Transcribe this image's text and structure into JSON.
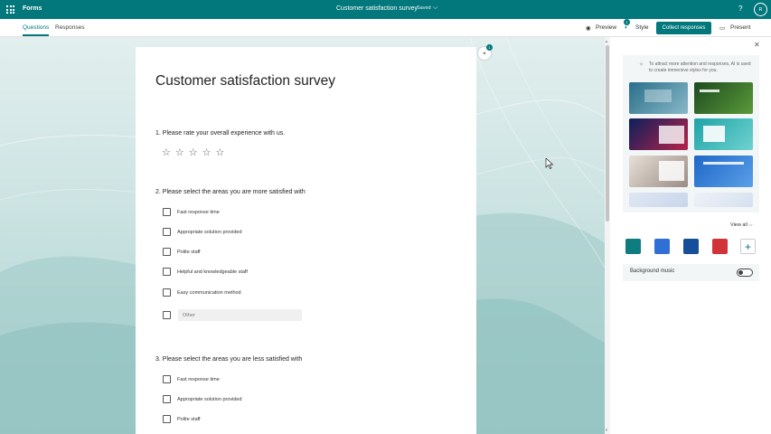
{
  "topbar": {
    "app_name": "Forms",
    "doc_title": "Customer satisfaction survey",
    "saved": "Saved",
    "help": "?",
    "avatar": "R",
    "color": "#03787c"
  },
  "subbar": {
    "tabs": [
      "Questions",
      "Responses"
    ],
    "preview": "Preview",
    "style": "Style",
    "style_badge": "1",
    "collect": "Collect responses",
    "present": "Present",
    "more": "···"
  },
  "form": {
    "title": "Customer satisfaction survey",
    "questions": [
      {
        "title": "1. Please rate your overall experience with us.",
        "type": "rating",
        "stars": 5
      },
      {
        "title": "2. Please select the areas you are more satisfied with",
        "type": "checkbox",
        "options": [
          "Fast response time",
          "Appropriate solution provided",
          "Polite staff",
          "Helpful and knowledgeable staff",
          "Easy communication method"
        ],
        "other_placeholder": "Other"
      },
      {
        "title": "3. Please select the areas you are less satisfied with",
        "type": "checkbox",
        "options": [
          "Fast response time",
          "Appropriate solution provided",
          "Polite staff"
        ]
      }
    ],
    "float_badge": "1"
  },
  "panel": {
    "ai_text": "To attract more attention and responses, AI is used to create immersive styles for you.",
    "view_all": "View all",
    "swatches": [
      "#0f7c7f",
      "#2f6fd6",
      "#164e9a",
      "#d13438"
    ],
    "background_music": "Background music",
    "music_on": false
  }
}
